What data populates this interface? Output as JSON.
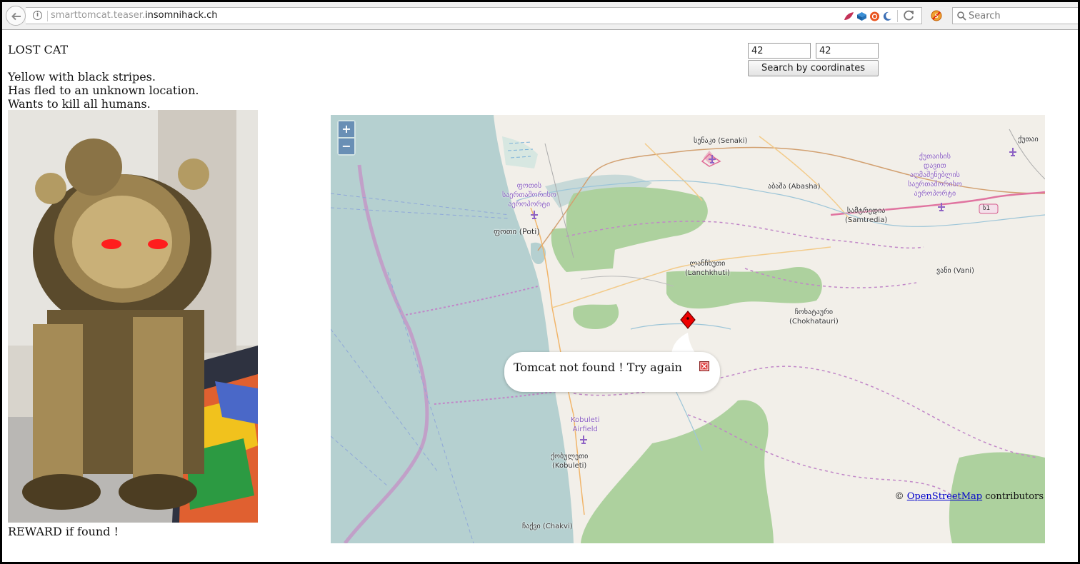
{
  "browser": {
    "url_prefix": "smarttomcat.teaser.",
    "url_domain": "insomnihack.ch",
    "search_placeholder": "Search"
  },
  "page": {
    "heading": "LOST CAT",
    "description_lines": [
      "Yellow with black stripes.",
      "Has fled to an unknown location.",
      "Wants to kill all humans."
    ],
    "reward": "REWARD if found !",
    "latitude": "42",
    "longitude": "42",
    "search_button": "Search by coordinates"
  },
  "map": {
    "zoom_in": "+",
    "zoom_out": "−",
    "popup_text": "Tomcat not found ! Try again",
    "attribution_prefix": "©",
    "attribution_link": "OpenStreetMap",
    "attribution_suffix": "contributors",
    "places": [
      {
        "native": "სენაკი (Senaki)",
        "latin": ""
      },
      {
        "native": "ქუთაი",
        "latin": ""
      },
      {
        "native": "აბაშა (Abasha)",
        "latin": ""
      },
      {
        "native": "ფოთი (Poti)",
        "latin": ""
      },
      {
        "native": "სამტრედია",
        "latin": "(Samtredia)"
      },
      {
        "native": "ლანჩხუთი",
        "latin": "(Lanchkhuti)"
      },
      {
        "native": "ვანი (Vani)",
        "latin": ""
      },
      {
        "native": "ჩოხატაური",
        "latin": "(Chokhatauri)"
      },
      {
        "native": "ქობულეთი",
        "latin": "(Kobuleti)"
      },
      {
        "native": "ჩაქვი (Chakvi)",
        "latin": ""
      }
    ],
    "airports": [
      {
        "lines": [
          "ფოთის",
          "საერთაშორისო",
          "აეროპორტი"
        ]
      },
      {
        "lines": [
          "ქუთაისის",
          "დავით",
          "აღმაშენებლის",
          "საერთაშორისო",
          "აეროპორტი"
        ]
      },
      {
        "lines": [
          "Kobuleti",
          "Airfield"
        ]
      }
    ],
    "road_shield": "ს1"
  }
}
